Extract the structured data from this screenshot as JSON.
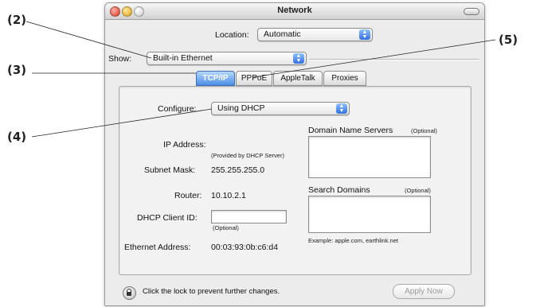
{
  "callouts": [
    "(2)",
    "(3)",
    "(4)",
    "(5)"
  ],
  "window": {
    "title": "Network"
  },
  "location": {
    "label": "Location:",
    "value": "Automatic"
  },
  "show": {
    "label": "Show:",
    "value": "Built-in Ethernet"
  },
  "tabs": [
    {
      "label": "TCP/IP",
      "active": true
    },
    {
      "label": "PPPoE",
      "active": false
    },
    {
      "label": "AppleTalk",
      "active": false
    },
    {
      "label": "Proxies",
      "active": false
    }
  ],
  "configure": {
    "label": "Configure:",
    "value": "Using DHCP"
  },
  "ip": {
    "label": "IP Address:",
    "note": "(Provided by DHCP Server)"
  },
  "subnet": {
    "label": "Subnet Mask:",
    "value": "255.255.255.0"
  },
  "router": {
    "label": "Router:",
    "value": "10.10.2.1"
  },
  "dhcp_client": {
    "label": "DHCP Client ID:",
    "value": "",
    "note": "(Optional)"
  },
  "ethernet": {
    "label": "Ethernet Address:",
    "value": "00:03:93:0b:c6:d4"
  },
  "dns": {
    "label": "Domain Name Servers",
    "note": "(Optional)",
    "value": ""
  },
  "search_domains": {
    "label": "Search Domains",
    "note": "(Optional)",
    "value": "",
    "example": "Example: apple.com, earthlink.net"
  },
  "footer": {
    "lock_text": "Click the lock to prevent further changes.",
    "apply_label": "Apply Now"
  },
  "colors": {
    "tab_active": "#4c8de6",
    "popup_arrows": "#2f6fe0"
  },
  "icons": {
    "lock": "lock-icon",
    "popup_arrows": "updown-arrows-icon"
  }
}
